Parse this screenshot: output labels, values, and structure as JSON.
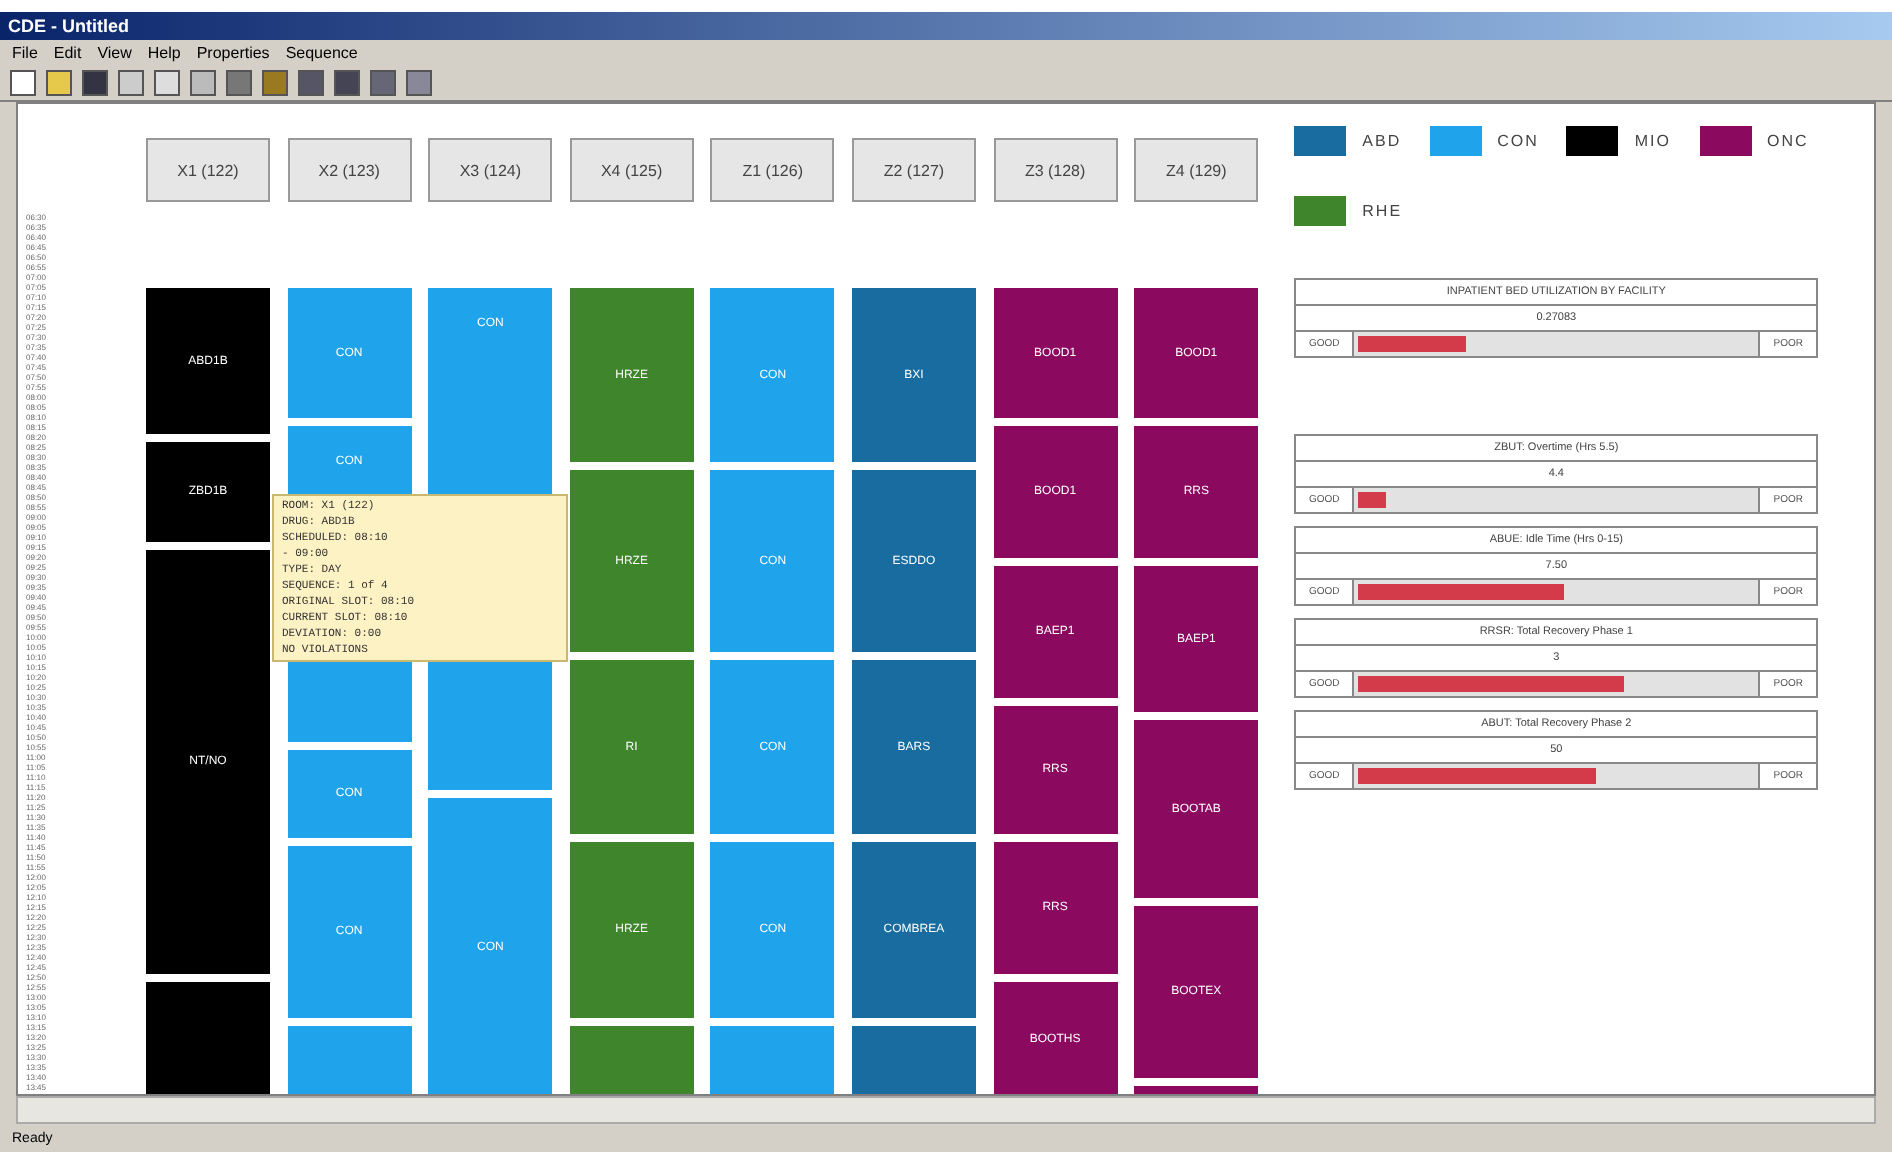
{
  "window": {
    "title": "CDE - Untitled"
  },
  "menu": [
    {
      "label": "File"
    },
    {
      "label": "Edit"
    },
    {
      "label": "View"
    },
    {
      "label": "Help"
    },
    {
      "label": "Properties"
    },
    {
      "label": "Sequence"
    }
  ],
  "toolbar": [
    {
      "kind": "new"
    },
    {
      "kind": "open"
    },
    {
      "kind": "save"
    },
    {
      "kind": "cut"
    },
    {
      "kind": "copy"
    },
    {
      "kind": "paste"
    },
    {
      "kind": "print"
    },
    {
      "kind": "filter"
    },
    {
      "kind": "grid"
    },
    {
      "kind": "table"
    },
    {
      "kind": "chart"
    },
    {
      "kind": "columns"
    }
  ],
  "time_axis": [
    "06:30",
    "06:35",
    "06:40",
    "06:45",
    "06:50",
    "06:55",
    "07:00",
    "07:05",
    "07:10",
    "07:15",
    "07:20",
    "07:25",
    "07:30",
    "07:35",
    "07:40",
    "07:45",
    "07:50",
    "07:55",
    "08:00",
    "08:05",
    "08:10",
    "08:15",
    "08:20",
    "08:25",
    "08:30",
    "08:35",
    "08:40",
    "08:45",
    "08:50",
    "08:55",
    "09:00",
    "09:05",
    "09:10",
    "09:15",
    "09:20",
    "09:25",
    "09:30",
    "09:35",
    "09:40",
    "09:45",
    "09:50",
    "09:55",
    "10:00",
    "10:05",
    "10:10",
    "10:15",
    "10:20",
    "10:25",
    "10:30",
    "10:35",
    "10:40",
    "10:45",
    "10:50",
    "10:55",
    "11:00",
    "11:05",
    "11:10",
    "11:15",
    "11:20",
    "11:25",
    "11:30",
    "11:35",
    "11:40",
    "11:45",
    "11:50",
    "11:55",
    "12:00",
    "12:05",
    "12:10",
    "12:15",
    "12:20",
    "12:25",
    "12:30",
    "12:35",
    "12:40",
    "12:45",
    "12:50",
    "12:55",
    "13:00",
    "13:05",
    "13:10",
    "13:15",
    "13:20",
    "13:25",
    "13:30",
    "13:35",
    "13:40",
    "13:45"
  ],
  "columns": [
    {
      "header": "X1 (122)",
      "blocks": [
        {
          "label": "ABD1B",
          "color": "#000000"
        },
        {
          "label": "ZBD1B",
          "color": "#000000"
        },
        {
          "label": "NT/NO",
          "color": "#000000"
        },
        {
          "color": "#000000"
        }
      ]
    },
    {
      "header": "X2 (123)",
      "blocks": [
        {
          "label": "CON",
          "color": "#1fa3ea"
        },
        {
          "label": "CON",
          "color": "#1fa3ea"
        },
        {
          "label": "CON",
          "color": "#1fa3ea"
        },
        {
          "label": "CON",
          "color": "#1fa3ea"
        },
        {
          "color": "#1fa3ea"
        }
      ]
    },
    {
      "header": "X3 (124)",
      "blocks": [
        {
          "label": "CON",
          "color": "#1fa3ea"
        },
        {
          "label": "CON",
          "color": "#1fa3ea"
        }
      ]
    },
    {
      "header": "X4 (125)",
      "blocks": [
        {
          "label": "HRZE",
          "color": "#3f852c"
        },
        {
          "label": "HRZE",
          "color": "#3f852c"
        },
        {
          "label": "RI",
          "color": "#3f852c"
        },
        {
          "label": "HRZE",
          "color": "#3f852c"
        },
        {
          "color": "#3f852c"
        }
      ]
    },
    {
      "header": "Z1 (126)",
      "blocks": [
        {
          "label": "CON",
          "color": "#1fa3ea"
        },
        {
          "label": "CON",
          "color": "#1fa3ea"
        },
        {
          "label": "CON",
          "color": "#1fa3ea"
        },
        {
          "label": "CON",
          "color": "#1fa3ea"
        },
        {
          "color": "#1fa3ea"
        }
      ]
    },
    {
      "header": "Z2 (127)",
      "blocks": [
        {
          "label": "BXI",
          "color": "#186c9f"
        },
        {
          "label": "ESDDO",
          "color": "#186c9f"
        },
        {
          "label": "BARS",
          "color": "#186c9f"
        },
        {
          "label": "COMBREA",
          "color": "#186c9f"
        },
        {
          "color": "#186c9f"
        }
      ]
    },
    {
      "header": "Z3 (128)",
      "blocks": [
        {
          "label": "BOOD1",
          "color": "#8b0a5f"
        },
        {
          "label": "BOOD1",
          "color": "#8b0a5f"
        },
        {
          "label": "BAEP1",
          "color": "#8b0a5f"
        },
        {
          "label": "RRS",
          "color": "#8b0a5f"
        },
        {
          "label": "RRS",
          "color": "#8b0a5f"
        },
        {
          "label": "BOOTHS",
          "color": "#8b0a5f"
        }
      ]
    },
    {
      "header": "Z4 (129)",
      "blocks": [
        {
          "label": "BOOD1",
          "color": "#8b0a5f"
        },
        {
          "label": "RRS",
          "color": "#8b0a5f"
        },
        {
          "label": "BAEP1",
          "color": "#8b0a5f"
        },
        {
          "label": "BOOTAB",
          "color": "#8b0a5f"
        },
        {
          "label": "BOOTEX",
          "color": "#8b0a5f"
        },
        {
          "color": "#8b0a5f"
        }
      ]
    }
  ],
  "tooltip": [
    "ROOM: X1 (122)",
    "DRUG: ABD1B",
    "SCHEDULED: 08:10",
    "  - 09:00",
    "TYPE: DAY",
    "SEQUENCE: 1 of 4",
    "ORIGINAL SLOT: 08:10",
    "CURRENT SLOT: 08:10",
    "DEVIATION: 0:00",
    "NO VIOLATIONS"
  ],
  "legend": [
    {
      "label": "ABD",
      "color": "#186c9f"
    },
    {
      "label": "CON",
      "color": "#1fa3ea"
    },
    {
      "label": "MIO",
      "color": "#000000"
    },
    {
      "label": "ONC",
      "color": "#8b0a5f"
    },
    {
      "label": "RHE",
      "color": "#3f852c"
    }
  ],
  "metrics": [
    {
      "title": "INPATIENT BED UTILIZATION BY FACILITY",
      "value": "0.27083",
      "good": "GOOD",
      "poor": "POOR",
      "level": 0.27
    },
    {
      "title": "ZBUT: Overtime (Hrs 5.5)",
      "value": "4.4",
      "good": "GOOD",
      "poor": "POOR",
      "level": 0.07
    },
    {
      "title": "ABUE: Idle Time (Hrs 0-15)",
      "value": "7.50",
      "good": "GOOD",
      "poor": "POOR",
      "level": 0.52
    },
    {
      "title": "RRSR: Total Recovery Phase 1",
      "value": "3",
      "good": "GOOD",
      "poor": "POOR",
      "level": 0.67
    },
    {
      "title": "ABUT: Total Recovery Phase 2",
      "value": "50",
      "good": "GOOD",
      "poor": "POOR",
      "level": 0.6
    }
  ],
  "status_bar": {
    "text": "Ready"
  }
}
